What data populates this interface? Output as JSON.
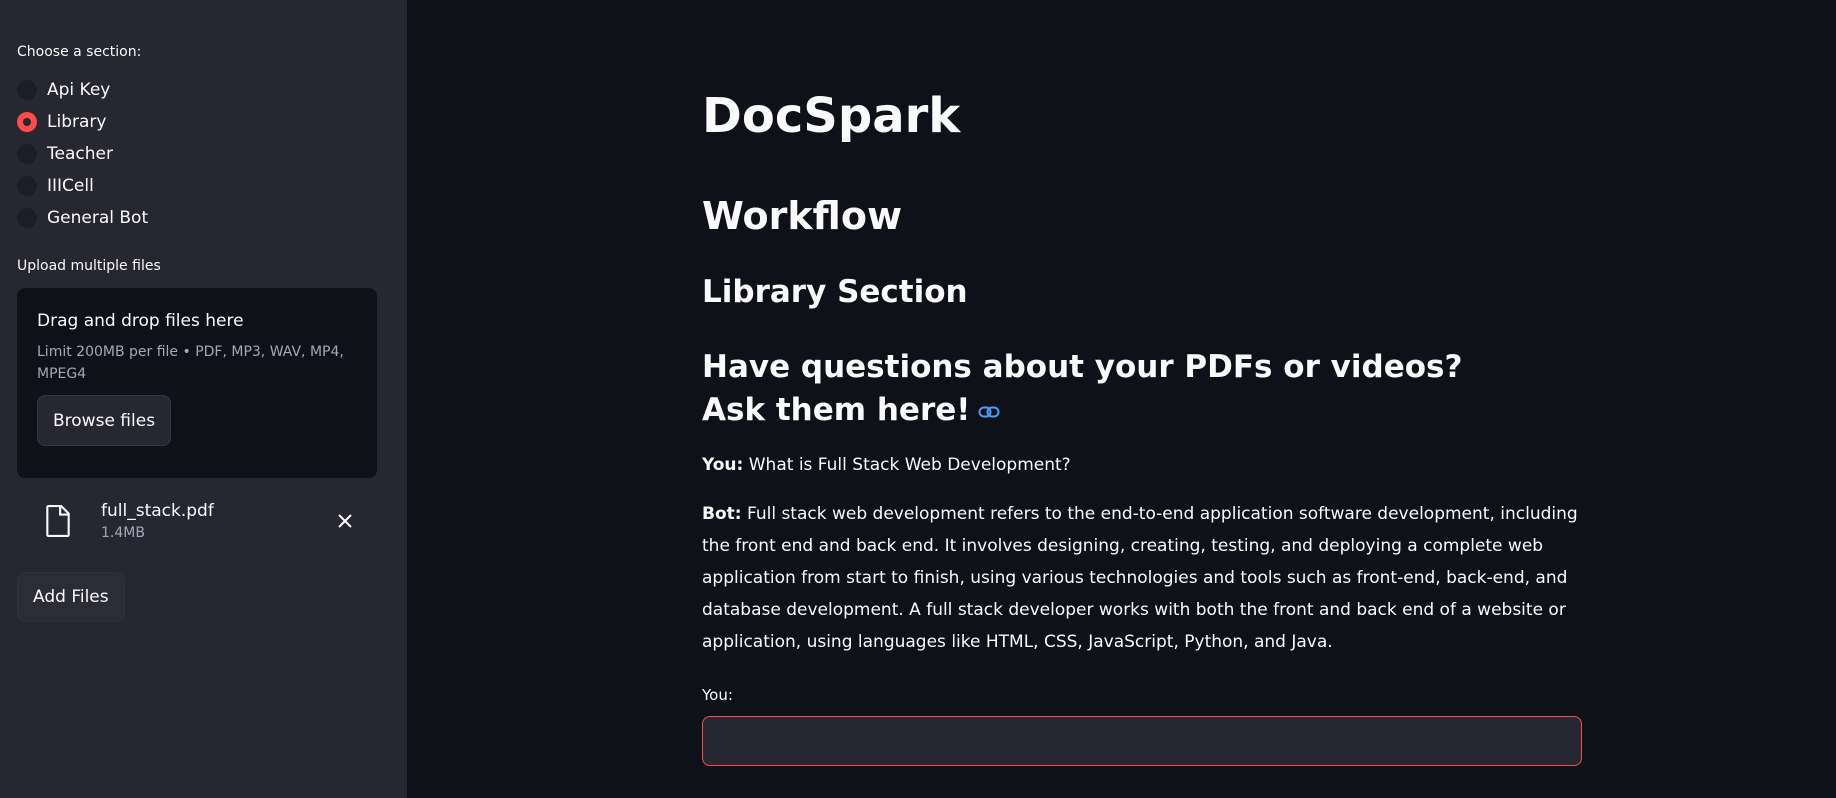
{
  "sidebar": {
    "section_label": "Choose a section:",
    "sections": [
      {
        "label": "Api Key",
        "selected": false
      },
      {
        "label": "Library",
        "selected": true
      },
      {
        "label": "Teacher",
        "selected": false
      },
      {
        "label": "IIICell",
        "selected": false
      },
      {
        "label": "General Bot",
        "selected": false
      }
    ],
    "upload_label": "Upload multiple files",
    "dropzone": {
      "title": "Drag and drop files here",
      "limit": "Limit 200MB per file • PDF, MP3, WAV, MP4, MPEG4",
      "browse_label": "Browse files"
    },
    "file": {
      "name": "full_stack.pdf",
      "size": "1.4MB",
      "icon": "file-icon"
    },
    "add_files_label": "Add Files"
  },
  "main": {
    "title": "DocSpark",
    "workflow_heading": "Workflow",
    "library_heading": "Library Section",
    "question_heading": "Have questions about your PDFs or videos? Ask them here!",
    "messages": [
      {
        "speaker": "You:",
        "text": " What is Full Stack Web Development?"
      },
      {
        "speaker": "Bot:",
        "text": " Full stack web development refers to the end-to-end application software development, including the front end and back end. It involves designing, creating, testing, and deploying a complete web application from start to finish, using various technologies and tools such as front-end, back-end, and database development. A full stack developer works with both the front and back end of a website or application, using languages like HTML, CSS, JavaScript, Python, and Java."
      }
    ],
    "input_label": "You:",
    "input_value": ""
  },
  "colors": {
    "accent": "#ff4b4b",
    "sidebar_bg": "#262730",
    "main_bg": "#0e1117",
    "link": "#4a9eff"
  }
}
